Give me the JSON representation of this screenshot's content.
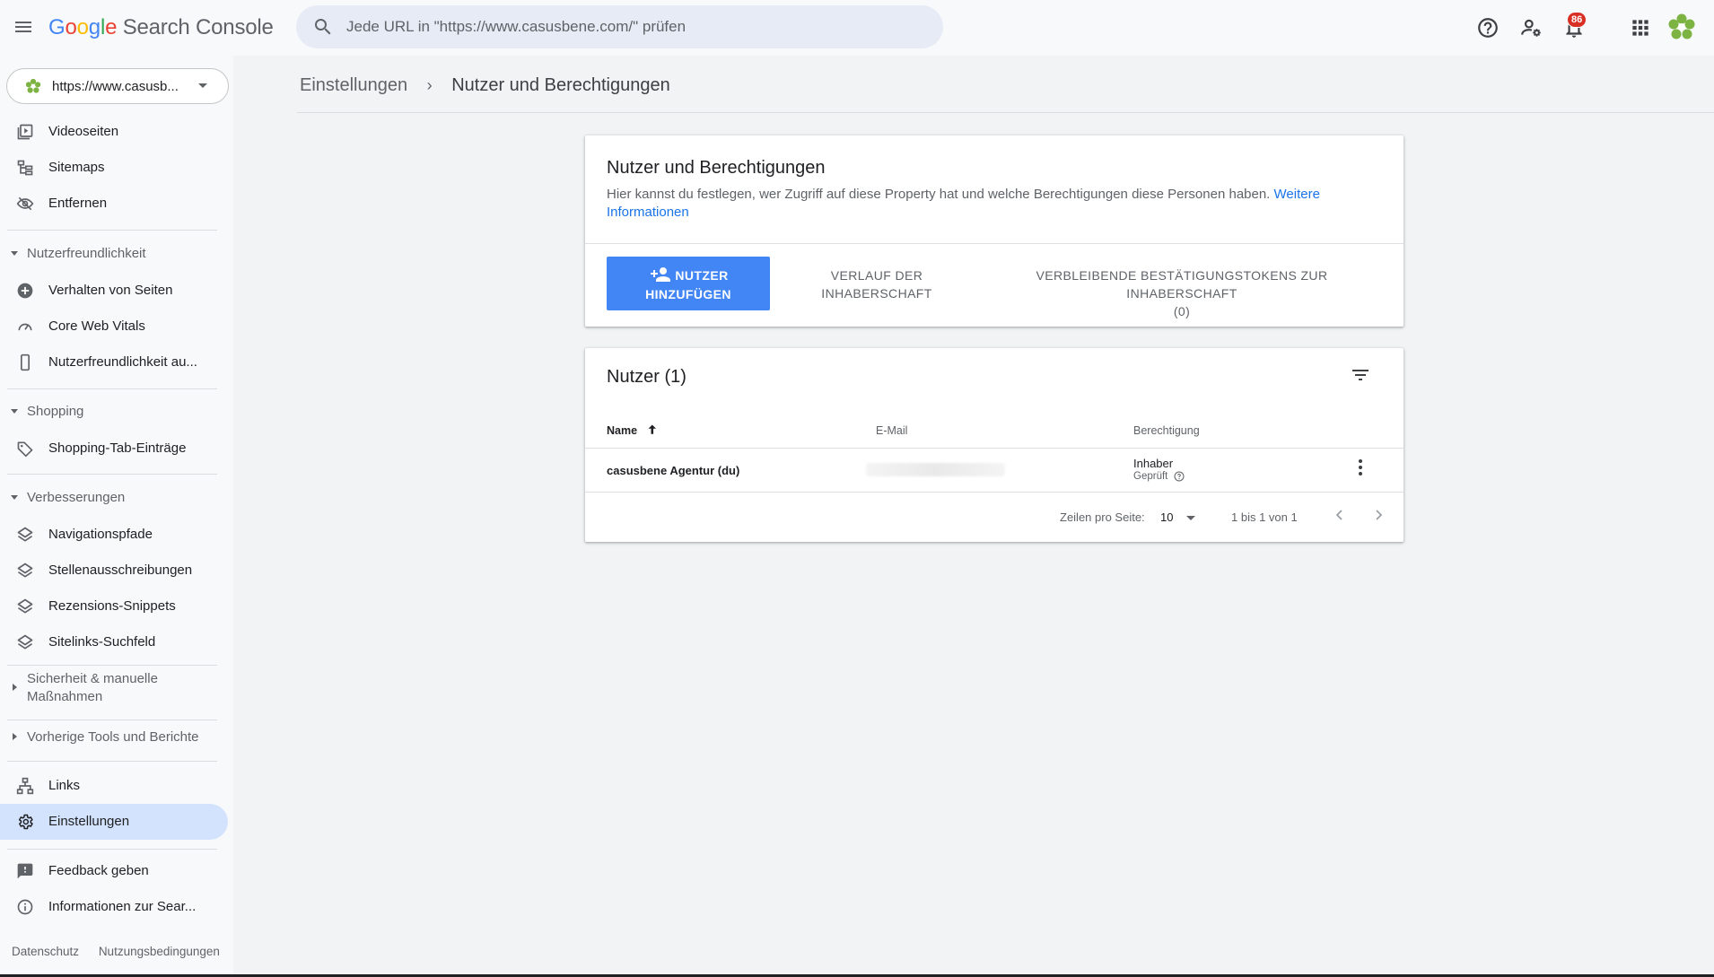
{
  "header": {
    "logo_word_parts": [
      "G",
      "o",
      "o",
      "g",
      "l",
      "e"
    ],
    "product": "Search Console",
    "search_placeholder": "Jede URL in \"https://www.casusbene.com/\" prüfen",
    "notification_count": "86"
  },
  "property": {
    "url": "https://www.casusb..."
  },
  "sidebar": {
    "top_items": [
      {
        "label": "Videoseiten",
        "icon": "video-pages-icon"
      },
      {
        "label": "Sitemaps",
        "icon": "sitemap-icon"
      },
      {
        "label": "Entfernen",
        "icon": "removals-icon"
      }
    ],
    "sections": {
      "experience": {
        "header": "Nutzerfreundlichkeit",
        "items": [
          {
            "label": "Verhalten von Seiten",
            "icon": "page-experience-icon"
          },
          {
            "label": "Core Web Vitals",
            "icon": "speedometer-icon"
          },
          {
            "label": "Nutzerfreundlichkeit au...",
            "icon": "mobile-icon"
          }
        ]
      },
      "shopping": {
        "header": "Shopping",
        "items": [
          {
            "label": "Shopping-Tab-Einträge",
            "icon": "tag-icon"
          }
        ]
      },
      "enhancements": {
        "header": "Verbesserungen",
        "items": [
          {
            "label": "Navigationspfade",
            "icon": "layers-icon"
          },
          {
            "label": "Stellenausschreibungen",
            "icon": "layers-icon"
          },
          {
            "label": "Rezensions-Snippets",
            "icon": "layers-icon"
          },
          {
            "label": "Sitelinks-Suchfeld",
            "icon": "layers-icon"
          }
        ]
      },
      "security": {
        "header": "Sicherheit & manuelle Maßnahmen"
      },
      "legacy": {
        "header": "Vorherige Tools und Berichte"
      }
    },
    "bottom_items": [
      {
        "label": "Links",
        "icon": "links-icon"
      },
      {
        "label": "Einstellungen",
        "icon": "gear-icon"
      }
    ],
    "extra_items": [
      {
        "label": "Feedback geben",
        "icon": "feedback-icon"
      },
      {
        "label": "Informationen zur Sear...",
        "icon": "info-icon"
      }
    ],
    "footer": {
      "privacy": "Datenschutz",
      "terms": "Nutzungsbedingungen"
    }
  },
  "breadcrumb": {
    "parent": "Einstellungen",
    "separator": "›",
    "current": "Nutzer und Berechtigungen"
  },
  "permissions_card": {
    "title": "Nutzer und Berechtigungen",
    "description": "Hier kannst du festlegen, wer Zugriff auf diese Property hat und welche Berechtigungen diese Personen haben.",
    "link_text": "Weitere Informationen",
    "add_user_line1": "NUTZER",
    "add_user_line2": "HINZUFÜGEN",
    "history_line1": "VERLAUF DER",
    "history_line2": "INHABERSCHAFT",
    "tokens_line1": "VERBLEIBENDE BESTÄTIGUNGSTOKENS ZUR INHABERSCHAFT",
    "tokens_line2": "(0)"
  },
  "users_card": {
    "title": "Nutzer (1)",
    "columns": {
      "name": "Name",
      "email": "E-Mail",
      "permission": "Berechtigung"
    },
    "rows": [
      {
        "name": "casusbene Agentur (du)",
        "permission": "Inhaber",
        "status": "Geprüft"
      }
    ],
    "pagination": {
      "rows_label": "Zeilen pro Seite:",
      "rows_value": "10",
      "range": "1 bis 1 von 1"
    }
  },
  "colors": {
    "accent": "#4285f4",
    "active_nav": "#d3e3fd",
    "badge": "#d93025",
    "link": "#1a73e8"
  }
}
